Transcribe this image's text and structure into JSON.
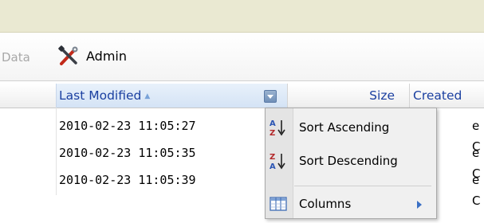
{
  "toolbar": {
    "data_label": "Data",
    "admin_label": "Admin",
    "admin_icon": "admin-tools-icon"
  },
  "grid": {
    "columns": [
      {
        "key": "last_modified",
        "label": "Last Modified",
        "sorted": "ascending"
      },
      {
        "key": "size",
        "label": "Size"
      },
      {
        "key": "created",
        "label": "Created"
      }
    ],
    "rows": [
      {
        "last_modified": "2010-02-23 11:05:27",
        "tail": "e C"
      },
      {
        "last_modified": "2010-02-23 11:05:35",
        "tail": "e C"
      },
      {
        "last_modified": "2010-02-23 11:05:39",
        "tail": "e C"
      }
    ]
  },
  "column_menu": {
    "items": [
      {
        "label": "Sort Ascending",
        "icon": "sort-ascending-icon"
      },
      {
        "label": "Sort Descending",
        "icon": "sort-descending-icon"
      },
      {
        "label": "Columns",
        "icon": "columns-icon",
        "has_submenu": true
      }
    ]
  },
  "colors": {
    "top_band": "#eae9d2",
    "header_text": "#1a3fa0",
    "sort_arrow": "#7aa3d8",
    "submenu_arrow": "#3a6fc4"
  }
}
